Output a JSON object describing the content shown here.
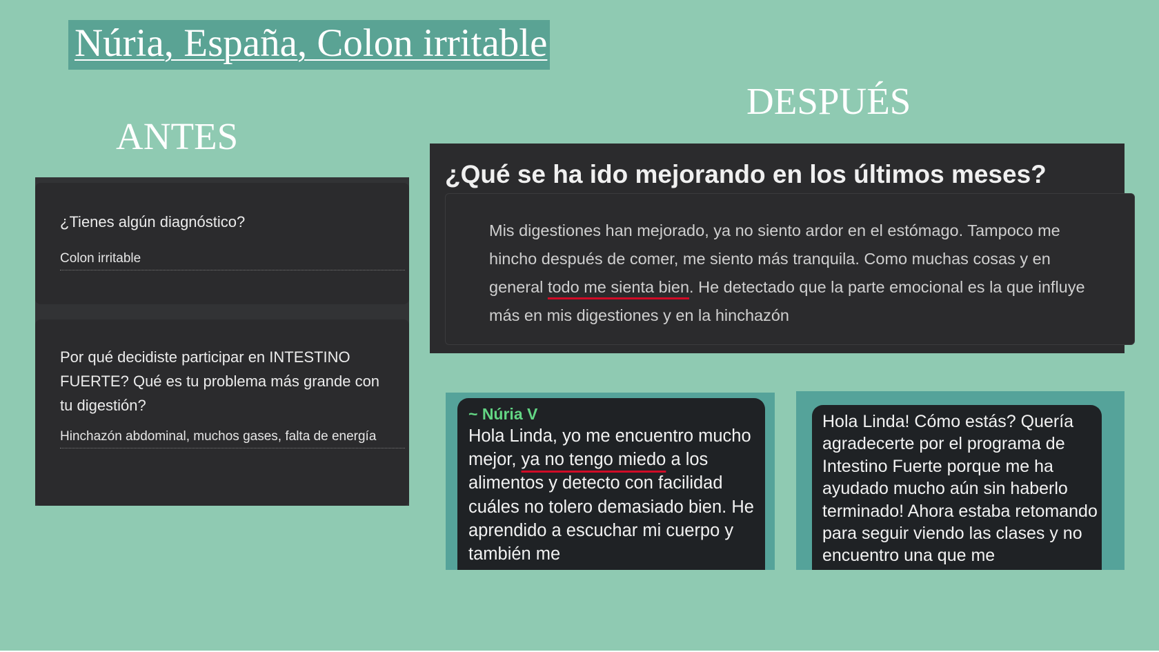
{
  "slide": {
    "title": "Núria, España, Colon irritable",
    "antes_heading": "ANTES",
    "despues_heading": "DESPUÉS",
    "background_color": "#8fcab2",
    "title_box_color": "#5aa394"
  },
  "antes_form": {
    "q1": "¿Tienes algún diagnóstico?",
    "a1": "Colon irritable",
    "q2": "Por qué decidiste participar en INTESTINO FUERTE? Qué es tu problema más grande con tu digestión?",
    "a2": "Hinchazón abdominal, muchos gases, falta de energía"
  },
  "despues_form": {
    "question": "¿Qué se ha ido mejorando en los últimos meses?",
    "answer_part1": "Mis digestiones han mejorado, ya no siento ardor en el estómago. Tampoco me hincho después de comer, me siento más tranquila. Como muchas cosas y en general ",
    "answer_highlight": "todo me sienta bien",
    "answer_part2": ". He detectado que la parte emocional es la que influye más en mis digestiones y en la hinchazón"
  },
  "chat_1": {
    "sender": "~ Núria V",
    "text_part1": "Hola Linda, yo me encuentro mucho mejor, ",
    "text_highlight": "ya no tengo miedo",
    "text_part2": " a los alimentos y detecto con facilidad cuáles no tolero demasiado bien. He aprendido a escuchar mi cuerpo y también me"
  },
  "chat_2": {
    "text": "Hola Linda! Cómo estás? Quería agradecerte por el programa de Intestino Fuerte porque me ha ayudado mucho aún sin haberlo terminado! Ahora estaba retomando para seguir viendo las clases y no encuentro una que me"
  },
  "colors": {
    "highlight_underline": "#d10b27",
    "sender_name": "#63d684"
  }
}
